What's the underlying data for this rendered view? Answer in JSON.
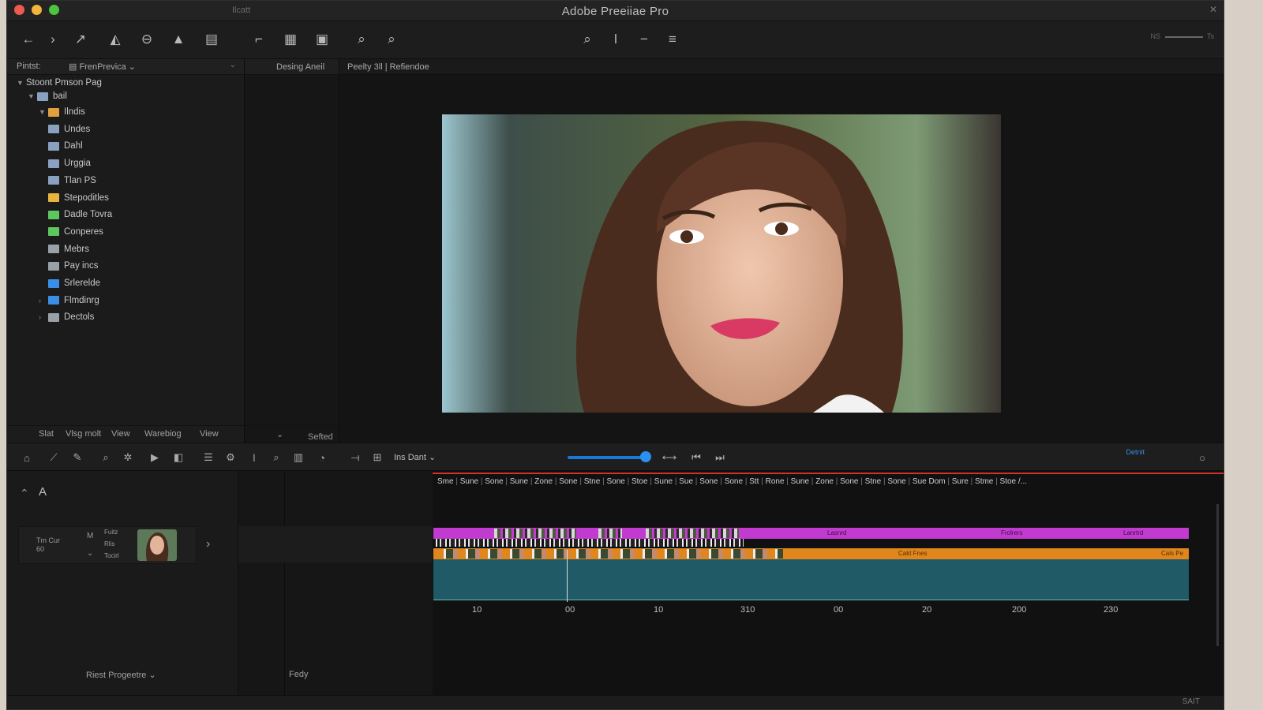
{
  "window": {
    "title": "Adobe Preeiiae Pro",
    "tab_label": "Ilcatt"
  },
  "toolbar": {
    "icons": [
      "back-arrow-icon",
      "forward-arrow-icon",
      "pen-icon",
      "shapes-icon",
      "link-icon",
      "pin-icon",
      "clip-icon",
      "crop-icon",
      "document-icon",
      "pages-icon",
      "search-icon",
      "zoom-search-icon",
      "magnify-icon",
      "marker-icon",
      "minus-icon",
      "list-icon"
    ],
    "zoom_left": "NS",
    "zoom_right": "Ts"
  },
  "project_panel": {
    "header_label": "Pintst:",
    "selector": "FrenPrevica",
    "root": "Stoont Pmson Pag",
    "group": "bail",
    "items": [
      {
        "label": "Ilndis",
        "color": "#e0a040"
      },
      {
        "label": "Undes",
        "color": "#8aa0c0"
      },
      {
        "label": "Dahl",
        "color": "#8aa0c0"
      },
      {
        "label": "Urggia",
        "color": "#8aa0c0"
      },
      {
        "label": "Tlan PS",
        "color": "#8aa0c0"
      },
      {
        "label": "Stepoditles",
        "color": "#e8b440"
      },
      {
        "label": "Dadle Tovra",
        "color": "#5ec65e"
      },
      {
        "label": "Conperes",
        "color": "#5ec65e"
      },
      {
        "label": "Mebrs",
        "color": "#9aa0a8"
      },
      {
        "label": "Pay incs",
        "color": "#9aa0a8"
      },
      {
        "label": "Srlerelde",
        "color": "#3a8ee6"
      },
      {
        "label": "Flmdinrg",
        "color": "#3a8ee6"
      },
      {
        "label": "Dectols",
        "color": "#9aa0a8"
      }
    ],
    "footer": [
      "Slat",
      "Vlsg molt",
      "View",
      "Warebiog",
      "View"
    ]
  },
  "source_panel": {
    "title": "Desing Aneil",
    "footer": "Sefted"
  },
  "program_panel": {
    "title": "Peelty 3ll | Refiendoe"
  },
  "timeline": {
    "sequence_label": "Ins Dant",
    "default_label": "Detnit",
    "scene_labels": [
      "Sme",
      "Sune",
      "Sone",
      "Sune",
      "Zone",
      "Sone",
      "Stne",
      "Sone",
      "Stoe",
      "Sune",
      "Sue",
      "Sone",
      "Sone",
      "Stt",
      "Rone",
      "Sune",
      "Zone",
      "Sone",
      "Stne",
      "Sone",
      "Sue Dom",
      "Sure",
      "Stme",
      "Stoe /..."
    ],
    "ticks": [
      "10",
      "00",
      "10",
      "310",
      "00",
      "20",
      "200",
      "230"
    ],
    "clip_labels": [
      "Lasnrd",
      "Frolrers",
      "Lanrtrd",
      "Cakt Fnes",
      "Cals Pe"
    ],
    "left_clip": {
      "title": "Tm Cur 60",
      "tag": "M",
      "list": [
        "Fuitz",
        "Rlis",
        "Tocirl"
      ]
    },
    "bottom_left": "Riest Progeetre",
    "bottom_mid": "Fedy",
    "status_right": "SAIT"
  }
}
